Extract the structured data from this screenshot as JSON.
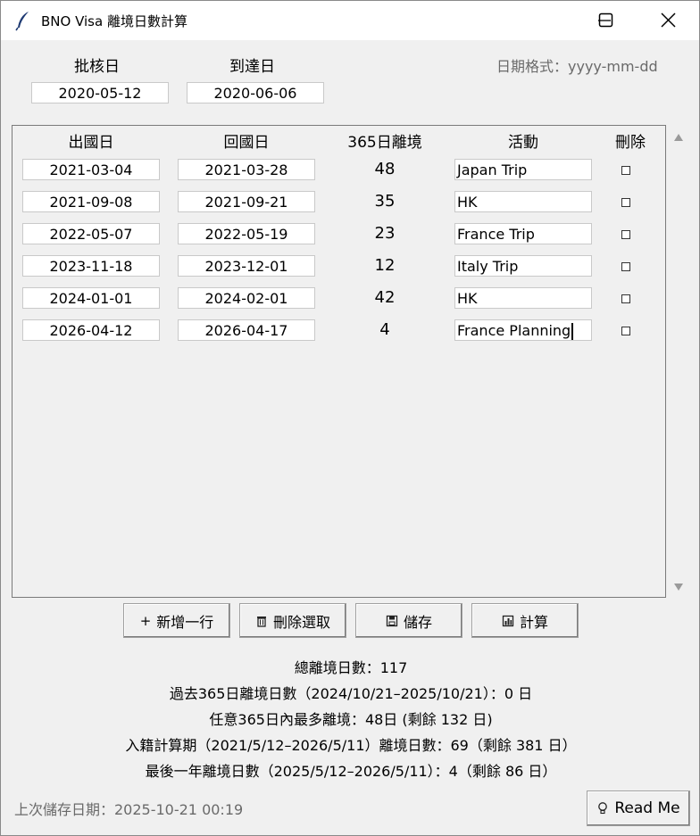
{
  "window": {
    "title": "BNO Visa 離境日數計算",
    "icon": "feather-icon"
  },
  "header": {
    "approval_label": "批核日",
    "approval_value": "2020-05-12",
    "arrival_label": "到達日",
    "arrival_value": "2020-06-06",
    "date_hint": "日期格式：yyyy-mm-dd"
  },
  "table": {
    "columns": [
      "出國日",
      "回國日",
      "365日離境",
      "活動",
      "刪除"
    ],
    "rows": [
      {
        "depart": "2021-03-04",
        "return": "2021-03-28",
        "days": "48",
        "activity": "Japan Trip",
        "delete": false
      },
      {
        "depart": "2021-09-08",
        "return": "2021-09-21",
        "days": "35",
        "activity": "HK",
        "delete": false
      },
      {
        "depart": "2022-05-07",
        "return": "2022-05-19",
        "days": "23",
        "activity": "France Trip",
        "delete": false
      },
      {
        "depart": "2023-11-18",
        "return": "2023-12-01",
        "days": "12",
        "activity": "Italy Trip",
        "delete": false
      },
      {
        "depart": "2024-01-01",
        "return": "2024-02-01",
        "days": "42",
        "activity": "HK",
        "delete": false
      },
      {
        "depart": "2026-04-12",
        "return": "2026-04-17",
        "days": "4",
        "activity": "France Planning",
        "delete": false
      }
    ]
  },
  "toolbar": {
    "add_label": "新增一行",
    "delete_label": "刪除選取",
    "save_label": "儲存",
    "calc_label": "計算"
  },
  "stats": {
    "total": "總離境日數：117",
    "past365": "過去365日離境日數（2024/10/21–2025/10/21）：0 日",
    "max365": "任意365日內最多離境：48日 (剩餘 132 日)",
    "naturalization": "入籍計算期（2021/5/12–2026/5/11）離境日數：69（剩餘 381 日）",
    "last_year": "最後一年離境日數（2025/5/12–2026/5/11）：4（剩餘 86 日）"
  },
  "footer": {
    "last_saved": "上次儲存日期：2025-10-21 00:19",
    "readme_label": "Read Me"
  }
}
